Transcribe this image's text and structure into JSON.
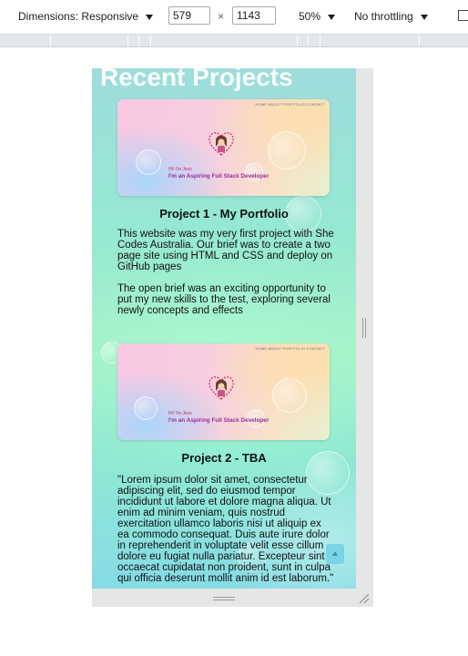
{
  "toolbar": {
    "dimensions_label": "Dimensions: Responsive",
    "width_value": "579",
    "times_symbol": "×",
    "height_value": "1143",
    "zoom_label": "50%",
    "throttling_label": "No throttling",
    "more_icon": "more-options-icon"
  },
  "page": {
    "heading": "Recent Projects",
    "projects": [
      {
        "title": "Project 1 - My Portfolio",
        "preview": {
          "nav": "HOME ABOUT PORTFOLIO CONTACT",
          "greeting": "Hi! I'm Jess",
          "tagline": "I'm an Aspiring Full Stack Developer"
        },
        "paragraph_1": "This website was my very first project with She Codes Australia. Our brief was to create a two page site using HTML and CSS and deploy on GitHub pages",
        "paragraph_2": "The open brief was an exciting opportunity to put my new skills to the test, exploring several newly concepts and effects"
      },
      {
        "title": "Project 2 - TBA",
        "preview": {
          "nav": "HOME ABOUT PORTFOLIO CONTACT",
          "greeting": "Hi! I'm Jess",
          "tagline": "I'm an Aspiring Full Stack Developer"
        },
        "paragraph_1": "\"Lorem ipsum dolor sit amet, consectetur adipiscing elit, sed do eiusmod tempor incididunt ut labore et dolore magna aliqua. Ut enim ad minim veniam, quis nostrud exercitation ullamco laboris nisi ut aliquip ex ea commodo consequat. Duis aute irure dolor in reprehenderit in voluptate velit esse cillum dolore eu fugiat nulla pariatur. Excepteur sint occaecat cupidatat non proident, sunt in culpa qui officia deserunt mollit anim id est laborum.\""
      }
    ],
    "scroll_top_icon": "arrow-up-icon"
  },
  "colors": {
    "page_background": "#9fe6d6",
    "heading": "#ffffff",
    "tagline": "#9b2aa0",
    "greeting": "#c02a78"
  }
}
